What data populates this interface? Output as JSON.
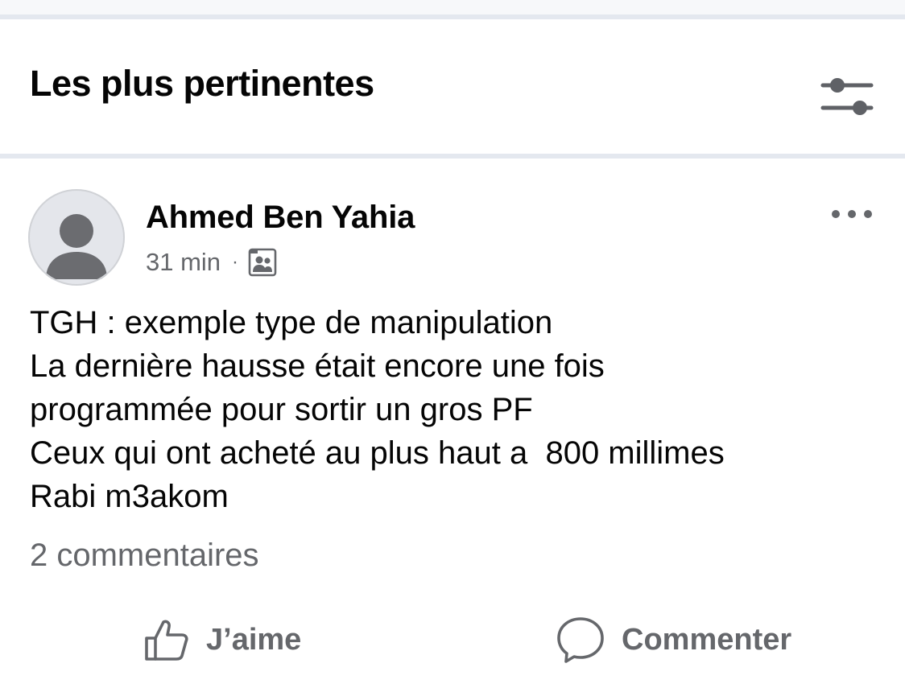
{
  "section": {
    "title": "Les plus pertinentes",
    "filter_icon": "sliders-icon"
  },
  "post": {
    "author": "Ahmed Ben Yahia",
    "time": "31 min",
    "separator": "·",
    "audience_icon": "group-audience-icon",
    "body_lines": [
      "TGH : exemple type de manipulation",
      "La dernière hausse était encore une fois",
      "programmée pour sortir un gros PF",
      "Ceux qui ont acheté au plus haut a  800 millimes",
      "Rabi m3akom"
    ],
    "comments_count": "2 commentaires"
  },
  "actions": {
    "like_label": "J’aime",
    "comment_label": "Commenter"
  },
  "colors": {
    "text": "#050505",
    "secondary": "#65676b",
    "divider": "#e4e8ef",
    "avatar_bg": "#e4e6eb",
    "avatar_fg": "#6b6c70"
  }
}
